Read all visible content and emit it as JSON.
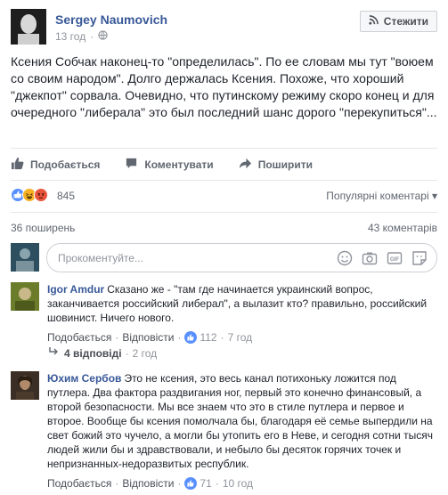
{
  "post": {
    "author": "Sergey Naumovich",
    "time": "13 год",
    "follow_label": "Стежити",
    "text": "Ксения Собчак наконец-то \"определилась\". По ее словам мы тут \"воюем со своим народом\". Долго держалась Ксения. Похоже, что хороший \"джекпот\" сорвала. Очевидно, что путинскому режиму скоро конец и для очередного \"либерала\" это был последний шанс дорого \"перекупиться\"..."
  },
  "actions": {
    "like": "Подобається",
    "comment": "Коментувати",
    "share": "Поширити"
  },
  "reactions": {
    "count": "845",
    "sort_label": "Популярні коментарі"
  },
  "stats": {
    "shares": "36 поширень",
    "comments": "43 коментарів"
  },
  "composer": {
    "placeholder": "Прокоментуйте..."
  },
  "comments": [
    {
      "name": "Igor Amdur",
      "text": "Сказано же - \"там где начинается украинский вопрос, заканчивается российский либерал\", а вылазит кто? правильно, российский шовинист. Ничего нового.",
      "like_label": "Подобається",
      "reply_label": "Відповісти",
      "likes": "112",
      "time": "7 год"
    },
    {
      "name": "Юхим Сербов",
      "text": "Это не ксения, это весь канал потихоньку ложится под путлера. Два фактора раздвигания ног, первый это конечно финансовый, а второй безопасности. Мы все знаем что это в стиле путлера и первое и второе. Вообще бы ксения помолчала бы, благодаря её семье выперди­ли на свет божий это чучело, а могли бы утопить его в Неве, и сегодня сотни тысяч людей жили бы и здравствовали, и небыло бы десяток горячих точек и непризнанных-недоразвитых республик.",
      "like_label": "Подобається",
      "reply_label": "Відповісти",
      "likes": "71",
      "time": "10 год"
    }
  ],
  "replies": {
    "label": "4 відповіді",
    "time": "2 год"
  },
  "colors": {
    "link": "#385898",
    "like": "#5890ff",
    "haha": "#f7b125",
    "angry": "#e9543d",
    "muted": "#90949c"
  }
}
